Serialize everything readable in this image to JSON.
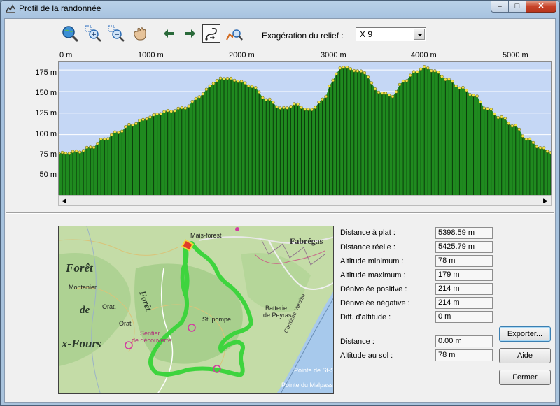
{
  "window": {
    "title": "Profil de la randonnée",
    "buttons": {
      "minimize": "–",
      "maximize": "□",
      "close": "✕"
    }
  },
  "toolbar": {
    "tools": [
      {
        "name": "zoom-globe",
        "icon": "globe-magnifier-icon"
      },
      {
        "name": "zoom-in",
        "icon": "zoom-in-icon"
      },
      {
        "name": "zoom-out",
        "icon": "zoom-out-icon"
      },
      {
        "name": "pan",
        "icon": "hand-icon"
      },
      {
        "name": "back",
        "icon": "arrow-left-icon"
      },
      {
        "name": "forward",
        "icon": "arrow-right-icon"
      },
      {
        "name": "route-mode",
        "icon": "route-icon",
        "active": true
      },
      {
        "name": "profile-search",
        "icon": "profile-magnifier-icon"
      }
    ],
    "relief_label": "Exagération du relief :",
    "relief_value": "X 9"
  },
  "chart_data": {
    "type": "area",
    "title": "",
    "xlabel": "",
    "ylabel": "",
    "x_ticks": [
      "0 m",
      "1000 m",
      "2000 m",
      "3000 m",
      "4000 m",
      "5000 m"
    ],
    "y_ticks": [
      "175 m",
      "150 m",
      "125 m",
      "100 m",
      "75 m",
      "50 m"
    ],
    "xlim": [
      0,
      5398.59
    ],
    "ylim": [
      30,
      184
    ],
    "x": [
      0,
      200,
      350,
      500,
      650,
      800,
      1000,
      1100,
      1250,
      1400,
      1550,
      1700,
      1800,
      1950,
      2100,
      2300,
      2450,
      2600,
      2750,
      2900,
      3000,
      3100,
      3200,
      3350,
      3500,
      3650,
      3800,
      3900,
      4000,
      4100,
      4250,
      4400,
      4550,
      4700,
      4850,
      5000,
      5150,
      5300,
      5398.59
    ],
    "y": [
      78,
      80,
      85,
      95,
      103,
      112,
      120,
      125,
      128,
      132,
      145,
      160,
      166,
      163,
      157,
      140,
      130,
      135,
      128,
      140,
      162,
      179,
      176,
      172,
      150,
      145,
      163,
      172,
      178,
      175,
      165,
      155,
      146,
      130,
      120,
      110,
      94,
      84,
      80
    ],
    "colors": {
      "fill": "#1f8a1f",
      "stroke": "#0b3d0b",
      "points": "#f2e24a",
      "background": "#c5d7f5"
    }
  },
  "map": {
    "labels": {
      "foret": "Forêt",
      "de": "de",
      "fours": "x-Fours",
      "foret_vertical": "Forêt",
      "fabregas": "Fabrégas",
      "batterie": "Batterie",
      "de_peyras": "de Peyras",
      "mais_forest": "Mais-forest",
      "montanier": "Montanier",
      "orat": "Orat.",
      "orat2": "Orat",
      "sentier": "Sentier",
      "de_decouverte": "de découverte",
      "st_pompe": "St. pompe",
      "pointe_st_selon": "Pointe de St-Selon",
      "pointe_malpasset": "Pointe du Malpasset",
      "corniche": "Corniche Varoise"
    },
    "colors": {
      "terrain": "#c4dca7",
      "forest": "#9fc987",
      "sea": "#a7c9ec",
      "track": "#3ed43e",
      "start": "#e03b2a"
    }
  },
  "stats": [
    {
      "label": "Distance à plat :",
      "value": "5398.59 m"
    },
    {
      "label": "Distance réelle :",
      "value": "5425.79 m"
    },
    {
      "label": "Altitude minimum :",
      "value": "78 m"
    },
    {
      "label": "Altitude maximum :",
      "value": "179 m"
    },
    {
      "label": "Dénivelée positive :",
      "value": "214 m"
    },
    {
      "label": "Dénivelée négative :",
      "value": "214 m"
    },
    {
      "label": "Diff. d'altitude :",
      "value": "0 m"
    }
  ],
  "cursor": [
    {
      "label": "Distance :",
      "value": "0.00 m"
    },
    {
      "label": "Altitude au sol :",
      "value": "78 m"
    }
  ],
  "buttons": {
    "export": "Exporter...",
    "help": "Aide",
    "close": "Fermer"
  }
}
